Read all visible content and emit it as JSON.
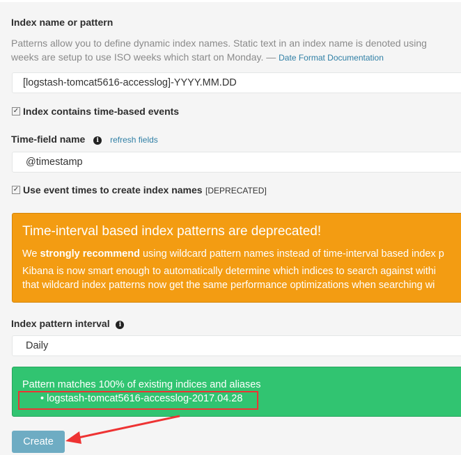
{
  "index_pattern": {
    "label": "Index name or pattern",
    "desc_line1": "Patterns allow you to define dynamic index names. Static text in an index name is denoted using",
    "desc_line2": "weeks are setup to use ISO weeks which start on Monday. —",
    "doc_link": "Date Format Documentation",
    "value": "[logstash-tomcat5616-accesslog]-YYYY.MM.DD"
  },
  "time_based": {
    "label": "Index contains time-based events",
    "checked": true
  },
  "time_field": {
    "label": "Time-field name",
    "refresh_link": "refresh fields",
    "value": "@timestamp",
    "info_icon": "info-circle-icon"
  },
  "event_times": {
    "label": "Use event times to create index names",
    "tag": "[DEPRECATED]",
    "checked": true
  },
  "warning": {
    "title": "Time-interval based index patterns are deprecated!",
    "line1_prefix": "We ",
    "line1_bold": "strongly recommend",
    "line1_rest": " using wildcard pattern names instead of time-interval based index p",
    "line2": "Kibana is now smart enough to automatically determine which indices to search against withi",
    "line3": "that wildcard index patterns now get the same performance optimizations when searching wi",
    "color": "#f39c12"
  },
  "interval": {
    "label": "Index pattern interval",
    "value": "Daily"
  },
  "match": {
    "text": "Pattern matches 100% of existing indices and aliases",
    "indices": [
      "logstash-tomcat5616-accesslog-2017.04.28"
    ],
    "color": "#31c471"
  },
  "create_button": {
    "label": "Create",
    "color": "#6eacc3"
  },
  "annotation_color": "#ee3333"
}
